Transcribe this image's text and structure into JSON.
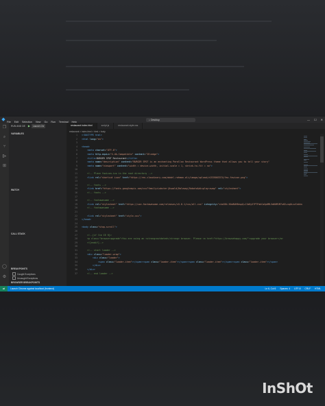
{
  "watermark": "InShOt",
  "window": {
    "title": "Desktop",
    "menu": [
      "File",
      "Edit",
      "Selection",
      "View",
      "Go",
      "Run",
      "Terminal",
      "Help"
    ]
  },
  "sidebar": {
    "header": "RUN AND DE",
    "launch_label": "Launch Chr",
    "sections": {
      "variables": "VARIABLES",
      "watch": "WATCH",
      "call_stack": "CALL STACK",
      "breakpoints": "BREAKPOINTS",
      "browser_breakpoints": "BROWSER BREAKPOINTS"
    },
    "breakpoint_items": [
      "Caught Exceptions",
      "Uncaught Exceptions"
    ]
  },
  "tabs": [
    {
      "label": "restaurant index.html"
    },
    {
      "label": "script.js"
    },
    {
      "label": "restaurant style.css"
    }
  ],
  "breadcrumb": "restaurant > index.html > html > body",
  "code_lines": [
    {
      "n": "1",
      "html": "<span class=\"tg\">&lt;!DOCTYPE html&gt;</span>"
    },
    {
      "n": "2",
      "html": "<span class=\"tg\">&lt;html</span> <span class=\"at\">lang</span>=<span class=\"st\">\"en\"</span><span class=\"tg\">&gt;</span>"
    },
    {
      "n": "3",
      "html": ""
    },
    {
      "n": "4",
      "html": "<span class=\"tg\">&lt;head&gt;</span>"
    },
    {
      "n": "5",
      "html": "    <span class=\"tg\">&lt;meta</span> <span class=\"at\">charset</span>=<span class=\"st\">\"UTF-8\"</span><span class=\"tg\">&gt;</span>"
    },
    {
      "n": "6",
      "html": "    <span class=\"tg\">&lt;meta</span> <span class=\"at\">http-equiv</span>=<span class=\"st\">\"X-UA-Compatible\"</span> <span class=\"at\">content</span>=<span class=\"st\">\"IE=edge\"</span><span class=\"tg\">&gt;</span>"
    },
    {
      "n": "7",
      "html": "    <span class=\"tg\">&lt;title&gt;</span>BURGER SPOT Restaurant<span class=\"tg\">&lt;/title&gt;</span>"
    },
    {
      "n": "8",
      "html": "    <span class=\"tg\">&lt;meta</span> <span class=\"at\">name</span>=<span class=\"st\">\"description\"</span> <span class=\"at\">content</span>=<span class=\"st\">\"BURGER SPOT is an enchanting Parallax Restaurant WordPress theme that allows you to tell your story\"</span>"
    },
    {
      "n": "9",
      "html": "    <span class=\"tg\">&lt;meta</span> <span class=\"at\">name</span>=<span class=\"st\">\"viewport\"</span> <span class=\"at\">content</span>=<span class=\"st\">\"width = device-width, initial-scale = 1, shrink-to-fit = no\"</span><span class=\"tg\">&gt;</span>"
    },
    {
      "n": "10",
      "html": ""
    },
    {
      "n": "11",
      "html": "    <span class=\"cm\">&lt;!-- Place favicon.ico in the root directory --&gt;</span>"
    },
    {
      "n": "12",
      "html": "    <span class=\"tg\">&lt;link</span> <span class=\"at\">rel</span>=<span class=\"st\">\"shortcut icon\"</span> <span class=\"at\">href</span>=<span class=\"st\">\"https://res.cloudinary.com/abdel-rahman-ali/image/upload/v1535003374/fav-favicon.png\"</span><span class=\"tg\">&gt;</span>"
    },
    {
      "n": "13",
      "html": ""
    },
    {
      "n": "14",
      "html": "    <span class=\"cm\">&lt;!-- fonts --&gt;</span>"
    },
    {
      "n": "15",
      "html": "    <span class=\"tg\">&lt;link</span> <span class=\"at\">href</span>=<span class=\"st\">\"https://fonts.googleapis.com/css?family=Lobster|Oswald|Raleway|Roboto&amp;display=swap\"</span> <span class=\"at\">rel</span>=<span class=\"st\">\"stylesheet\"</span><span class=\"tg\">&gt;</span>"
    },
    {
      "n": "16",
      "html": "    <span class=\"cm\">&lt;!-- fonts --&gt;</span>"
    },
    {
      "n": "17",
      "html": ""
    },
    {
      "n": "18",
      "html": "    <span class=\"cm\">&lt;!-- fontawesome --&gt;</span>"
    },
    {
      "n": "19",
      "html": "    <span class=\"tg\">&lt;link</span> <span class=\"at\">rel</span>=<span class=\"st\">\"stylesheet\"</span> <span class=\"at\">href</span>=<span class=\"st\">\"https://use.fontawesome.com/releases/v5.8.1/css/all.css\"</span> <span class=\"at\">integrity</span>=<span class=\"st\">\"sha384-50oBUHEmvpQ+1lW4y57PTFmhCaXp0ML5d60M1M7uH2+nqUivzIebhndOJK28anvf\"</span>"
    },
    {
      "n": "20",
      "html": "    <span class=\"cm\">&lt;!-- fontawesome --&gt;</span>"
    },
    {
      "n": "21",
      "html": ""
    },
    {
      "n": "22",
      "html": "    <span class=\"tg\">&lt;link</span> <span class=\"at\">rel</span>=<span class=\"st\">\"stylesheet\"</span> <span class=\"at\">href</span>=<span class=\"st\">\"style.css\"</span><span class=\"tg\">&gt;</span>"
    },
    {
      "n": "23",
      "html": "<span class=\"tg\">&lt;/head&gt;</span>"
    },
    {
      "n": "24",
      "html": ""
    },
    {
      "n": "25",
      "html": "<span class=\"tg\">&lt;body</span> <span class=\"at\">class</span>=<span class=\"st\">\"stop-scroll\"</span><span class=\"tg\">&gt;</span>"
    },
    {
      "n": "26",
      "html": ""
    },
    {
      "n": "27",
      "html": "    <span class=\"cm\">&lt;!--[if lte IE 9]&gt;</span>"
    },
    {
      "n": "28",
      "html": "    <span class=\"cm\">&lt;p class=\"browserupgrade\"&gt;You are using an &lt;strong&gt;outdated&lt;/strong&gt; browser. Please &lt;a href=\"https://browsehappy.com/\"&gt;upgrade your browser&lt;/a&gt;</span>"
    },
    {
      "n": "29",
      "html": "    <span class=\"cm\">&lt;![endif]--&gt;</span>"
    },
    {
      "n": "30",
      "html": ""
    },
    {
      "n": "31",
      "html": "    <span class=\"cm\">&lt;!-- start loader --&gt;</span>"
    },
    {
      "n": "32",
      "html": "    <span class=\"tg\">&lt;div</span> <span class=\"at\">class</span>=<span class=\"st\">\"loader-wrap\"</span><span class=\"tg\">&gt;</span>"
    },
    {
      "n": "33",
      "html": "        <span class=\"tg\">&lt;div</span> <span class=\"at\">class</span>=<span class=\"st\">\"loader\"</span><span class=\"tg\">&gt;</span>"
    },
    {
      "n": "34",
      "html": "            <span class=\"tg\">&lt;span</span> <span class=\"at\">class</span>=<span class=\"st\">\"loader-item\"</span><span class=\"tg\">&gt;&lt;/span&gt;&lt;span</span> <span class=\"at\">class</span>=<span class=\"st\">\"loader-item\"</span><span class=\"tg\">&gt;&lt;/span&gt;&lt;span</span> <span class=\"at\">class</span>=<span class=\"st\">\"loader-item\"</span><span class=\"tg\">&gt;&lt;/span&gt;&lt;span</span> <span class=\"at\">class</span>=<span class=\"st\">\"loader-item\"</span><span class=\"tg\">&gt;&lt;/span&gt;</span>"
    },
    {
      "n": "35",
      "html": "        <span class=\"tg\">&lt;/div&gt;</span>"
    },
    {
      "n": "36",
      "html": "    <span class=\"tg\">&lt;/div&gt;</span>"
    },
    {
      "n": "37",
      "html": "    <span class=\"cm\">&lt;!-- end loader --&gt;</span>"
    }
  ],
  "status": {
    "remote_icon": "remote-icon",
    "left": "Launch Chrome against localhost (frontend)",
    "right": [
      "Ln 6, Col 6",
      "Spaces: 4",
      "UTF-8",
      "CRLF",
      "HTML"
    ]
  }
}
